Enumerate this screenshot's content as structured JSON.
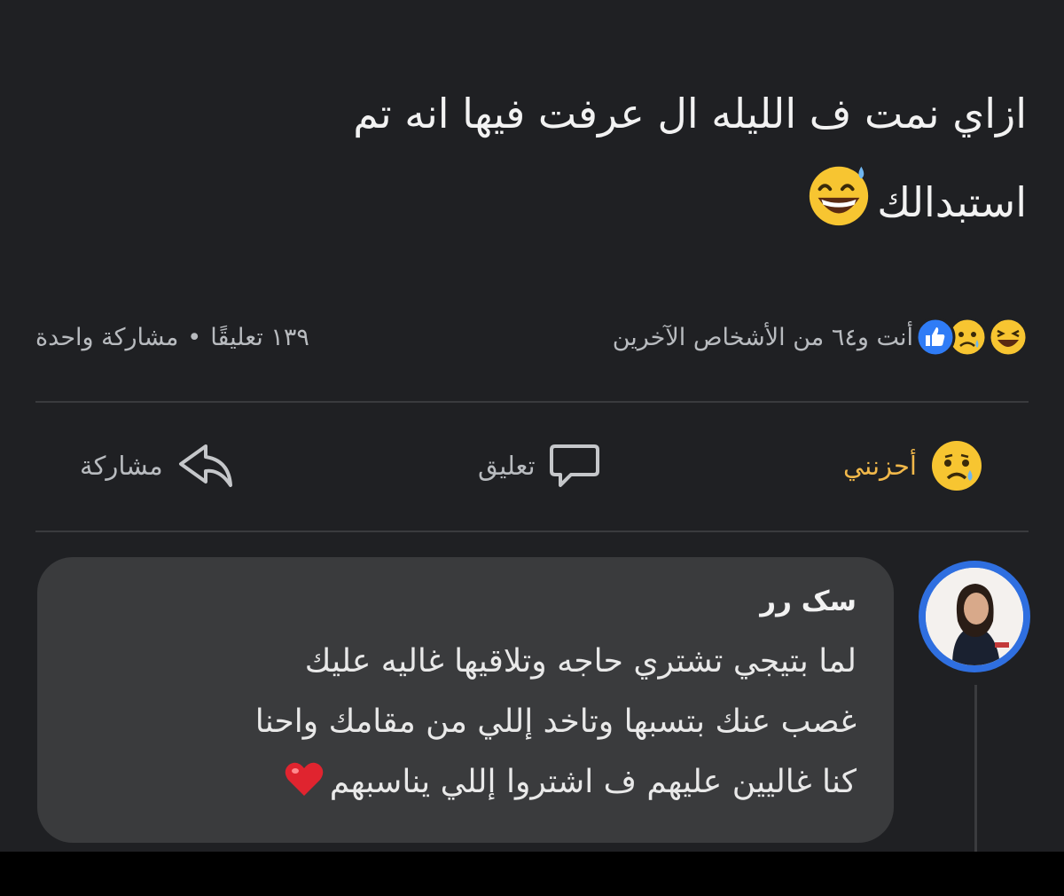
{
  "post": {
    "text_line_1": "ازاي نمت ف الليله ال عرفت فيها انه تم",
    "text_line_2": "استبدالك",
    "emoji_icon": "grinning-sweat-emoji-icon"
  },
  "reactions": {
    "reaction_icons": [
      "laughing-emoji-icon",
      "sad-emoji-icon",
      "like-icon"
    ],
    "reactors_text": "أنت و٦٤ من الأشخاص الآخرين",
    "comments_count": "١٣٩ تعليقًا",
    "separator": "•",
    "shares_count": "مشاركة واحدة"
  },
  "actions": {
    "reaction_label": "أحزنني",
    "reaction_icon": "sad-emoji-icon",
    "comment_label": "تعليق",
    "comment_icon": "speech-bubble-icon",
    "share_label": "مشاركة",
    "share_icon": "share-arrow-icon"
  },
  "comment": {
    "author": "سک رر",
    "lines": [
      "لما بتيجي تشتري حاجه وتلاقيها غاليه عليك",
      "غصب عنك بتسبها وتاخد إللي من مقامك واحنا",
      "كنا غاليين عليهم ف اشتروا إللي يناسبهم"
    ],
    "heart_icon": "red-heart-icon"
  },
  "colors": {
    "background": "#1f2023",
    "bubble": "#3a3b3d",
    "reaction_accent": "#f1b84a",
    "like_blue": "#2f7cf6"
  }
}
